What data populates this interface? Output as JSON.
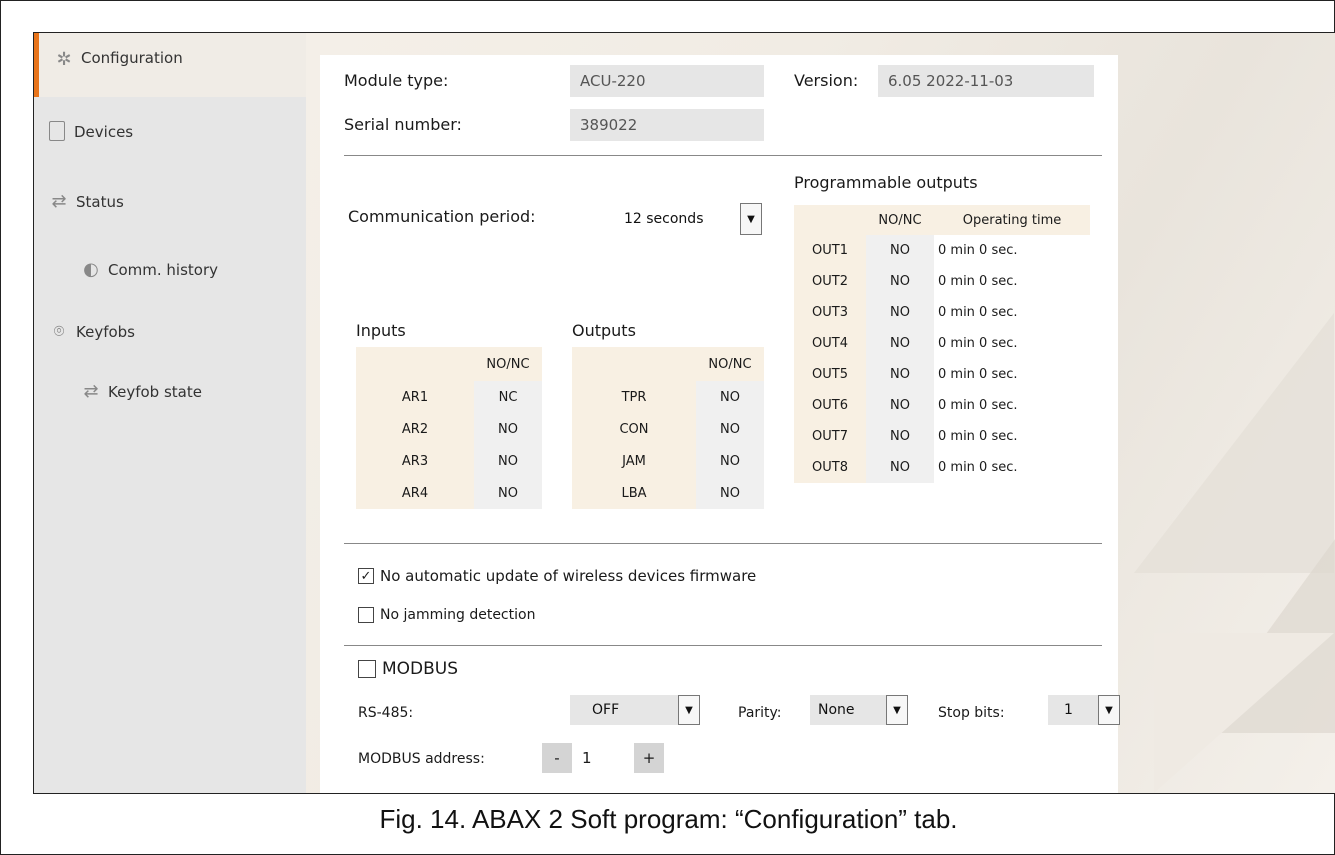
{
  "sidebar": {
    "items": [
      {
        "label": "Configuration",
        "icon": "configuration-icon"
      },
      {
        "label": "Devices",
        "icon": "devices-icon"
      },
      {
        "label": "Status",
        "icon": "status-icon"
      },
      {
        "label": "Comm. history",
        "icon": "comm-history-icon"
      },
      {
        "label": "Keyfobs",
        "icon": "keyfobs-icon"
      },
      {
        "label": "Keyfob state",
        "icon": "keyfob-state-icon"
      }
    ],
    "accent": "#e8741a"
  },
  "info": {
    "module_type_label": "Module type:",
    "module_type_value": "ACU-220",
    "version_label": "Version:",
    "version_value": "6.05 2022-11-03",
    "serial_label": "Serial number:",
    "serial_value": "389022"
  },
  "comm": {
    "label": "Communication period:",
    "value": "12 seconds"
  },
  "inputs": {
    "title": "Inputs",
    "header": "NO/NC",
    "rows": [
      {
        "name": "AR1",
        "value": "NC"
      },
      {
        "name": "AR2",
        "value": "NO"
      },
      {
        "name": "AR3",
        "value": "NO"
      },
      {
        "name": "AR4",
        "value": "NO"
      }
    ]
  },
  "outputs": {
    "title": "Outputs",
    "header": "NO/NC",
    "rows": [
      {
        "name": "TPR",
        "value": "NO"
      },
      {
        "name": "CON",
        "value": "NO"
      },
      {
        "name": "JAM",
        "value": "NO"
      },
      {
        "name": "LBA",
        "value": "NO"
      }
    ]
  },
  "prog_outputs": {
    "title": "Programmable outputs",
    "header_nonc": "NO/NC",
    "header_time": "Operating time",
    "rows": [
      {
        "name": "OUT1",
        "value": "NO",
        "time": "0 min 0 sec."
      },
      {
        "name": "OUT2",
        "value": "NO",
        "time": "0 min 0 sec."
      },
      {
        "name": "OUT3",
        "value": "NO",
        "time": "0 min 0 sec."
      },
      {
        "name": "OUT4",
        "value": "NO",
        "time": "0 min 0 sec."
      },
      {
        "name": "OUT5",
        "value": "NO",
        "time": "0 min 0 sec."
      },
      {
        "name": "OUT6",
        "value": "NO",
        "time": "0 min 0 sec."
      },
      {
        "name": "OUT7",
        "value": "NO",
        "time": "0 min 0 sec."
      },
      {
        "name": "OUT8",
        "value": "NO",
        "time": "0 min 0 sec."
      }
    ]
  },
  "options": {
    "no_auto_update": {
      "label": "No automatic update of wireless devices firmware",
      "checked": true
    },
    "no_jamming": {
      "label": "No jamming detection",
      "checked": false
    }
  },
  "modbus": {
    "label": "MODBUS",
    "checked": false,
    "rs485_label": "RS-485:",
    "rs485_value": "OFF",
    "parity_label": "Parity:",
    "parity_value": "None",
    "stopbits_label": "Stop bits:",
    "stopbits_value": "1",
    "address_label": "MODBUS address:",
    "address_value": "1",
    "minus": "-",
    "plus": "+"
  },
  "caption": "Fig. 14. ABAX 2 Soft program: “Configuration” tab."
}
